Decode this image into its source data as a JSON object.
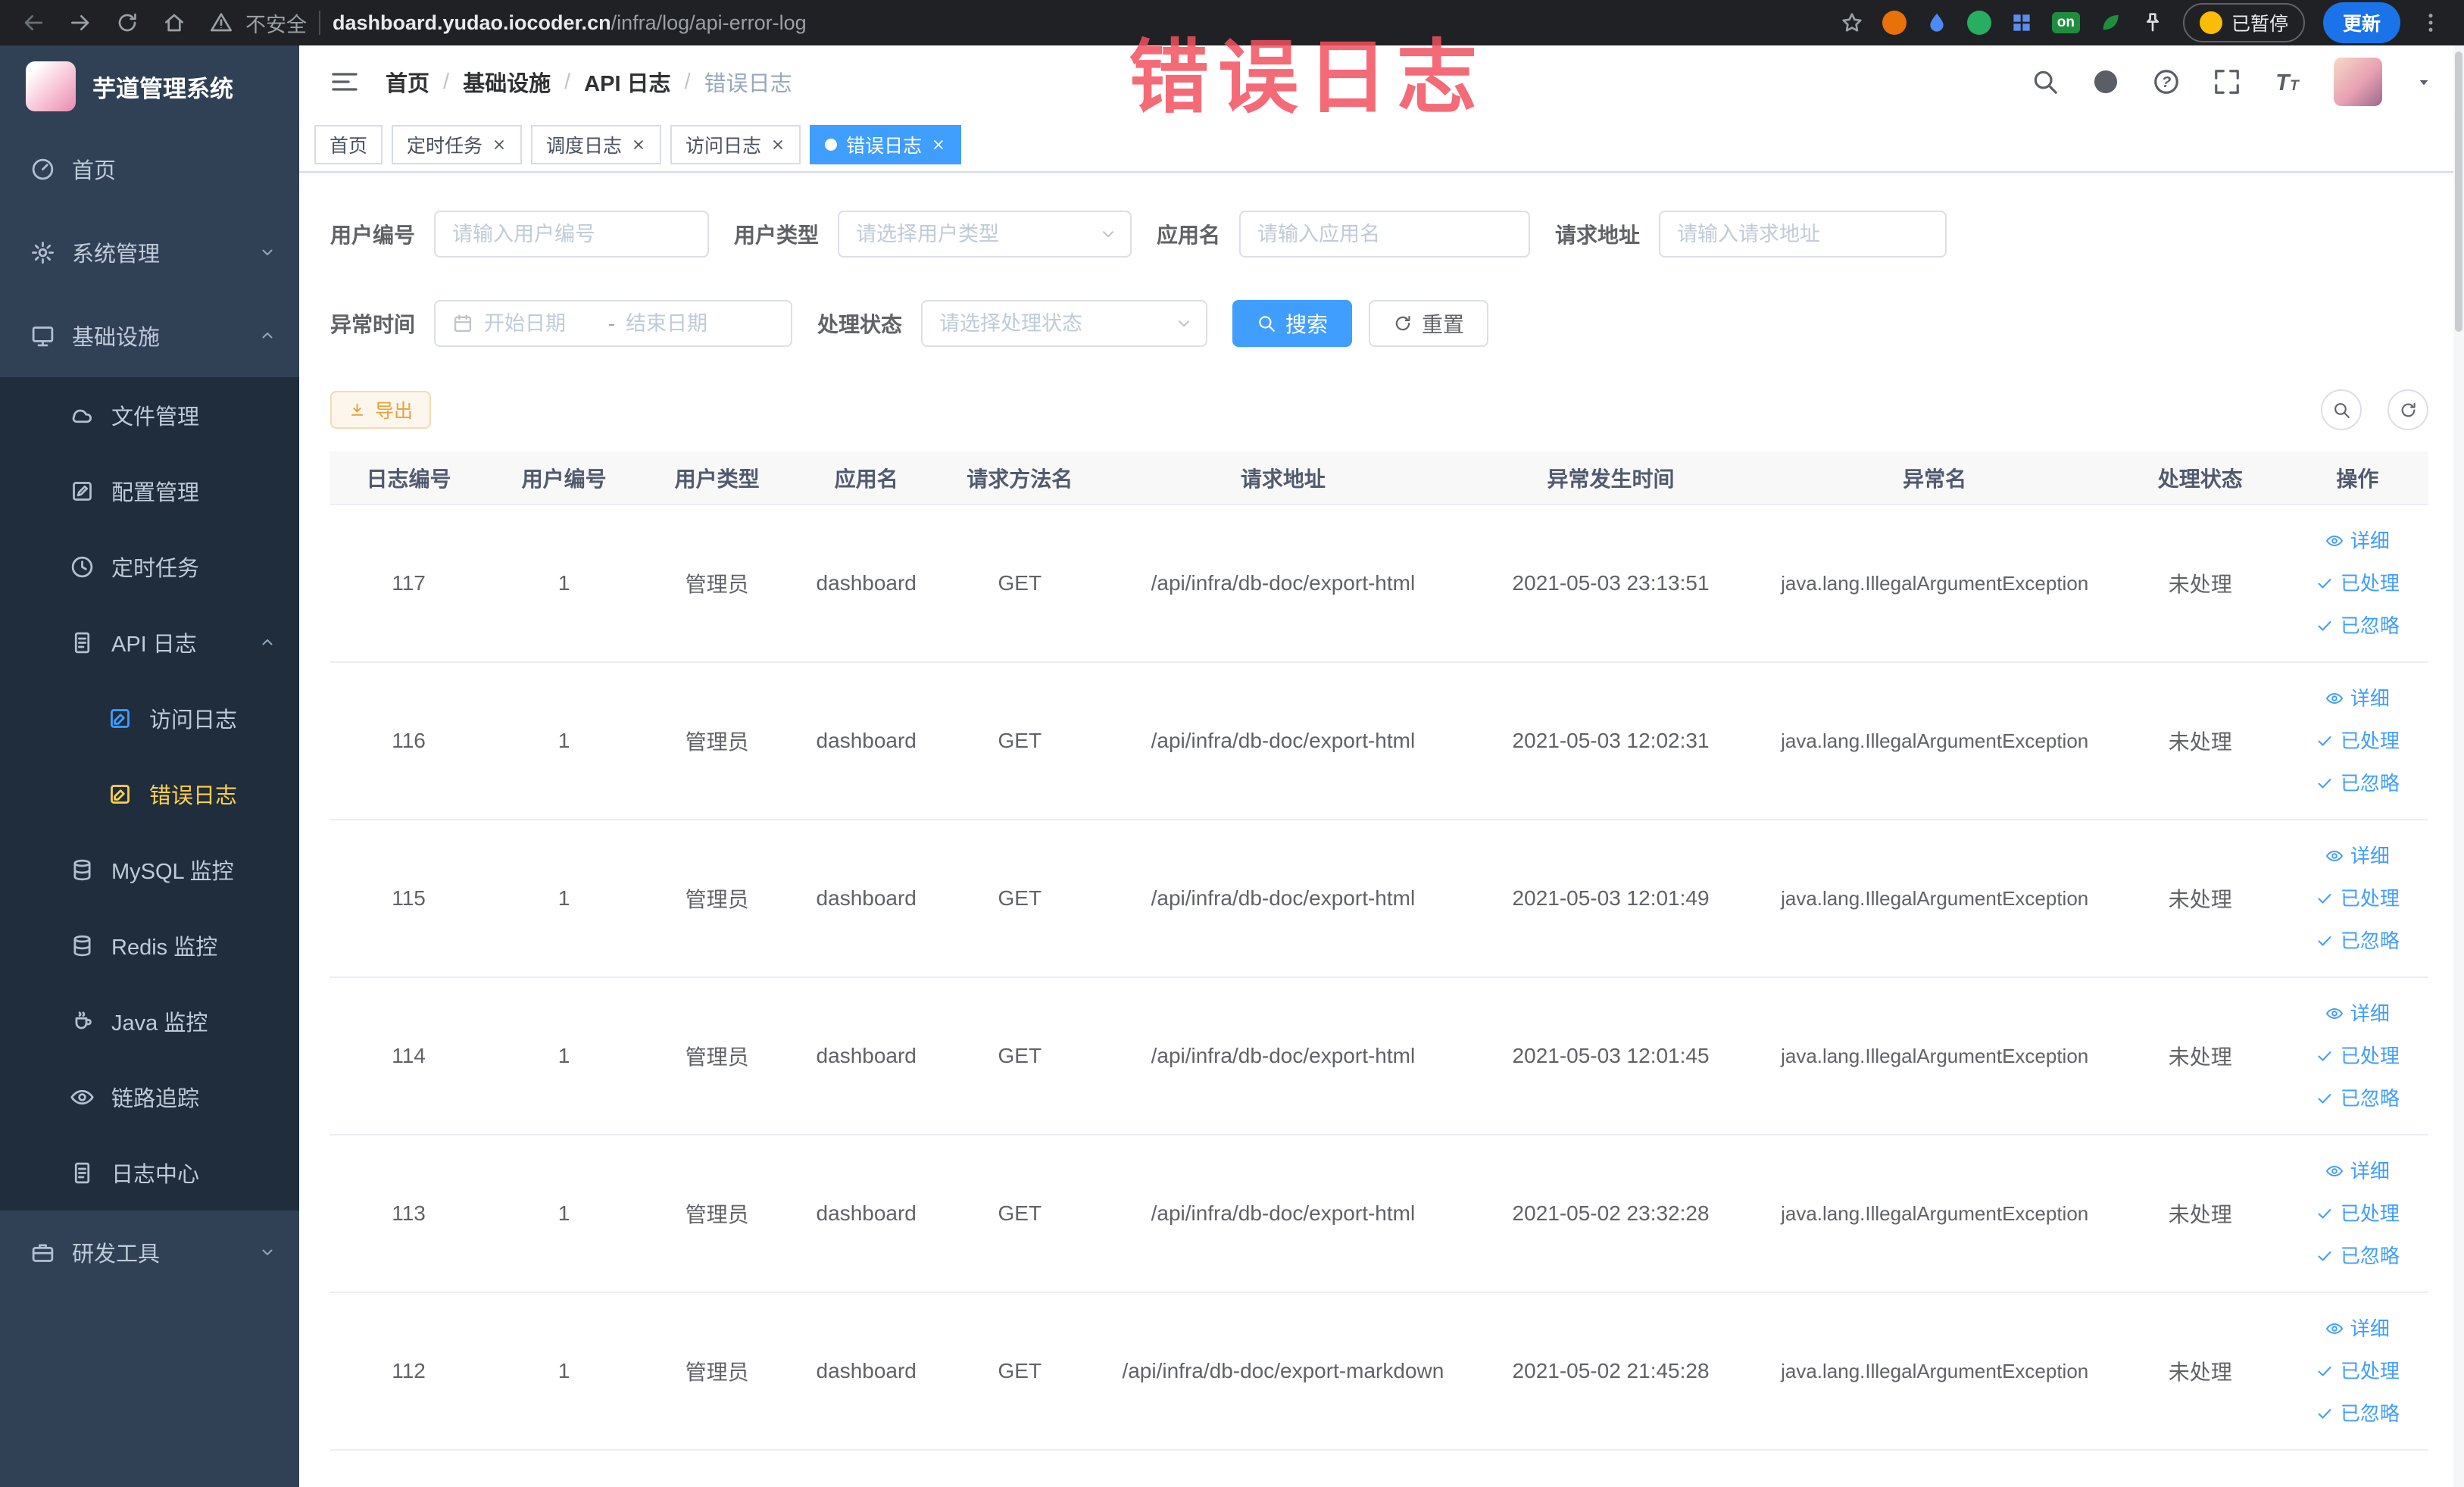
{
  "browser": {
    "security_label": "不安全",
    "url_domain": "dashboard.yudao.iocoder.cn",
    "url_path": "/infra/log/api-error-log",
    "extensions_badge": "on",
    "paused_label": "已暂停",
    "update_label": "更新"
  },
  "annotation": {
    "text": "错误日志",
    "color": "#f2505f"
  },
  "sidebar": {
    "logo_title": "芋道管理系统",
    "menu": [
      {
        "label": "首页"
      },
      {
        "label": "系统管理"
      },
      {
        "label": "基础设施"
      },
      {
        "label": "文件管理"
      },
      {
        "label": "配置管理"
      },
      {
        "label": "定时任务"
      },
      {
        "label": "API 日志"
      },
      {
        "label": "访问日志"
      },
      {
        "label": "错误日志"
      },
      {
        "label": "MySQL 监控"
      },
      {
        "label": "Redis 监控"
      },
      {
        "label": "Java 监控"
      },
      {
        "label": "链路追踪"
      },
      {
        "label": "日志中心"
      },
      {
        "label": "研发工具"
      }
    ]
  },
  "header": {
    "breadcrumb": [
      "首页",
      "基础设施",
      "API 日志",
      "错误日志"
    ],
    "separator": "/"
  },
  "tabs": [
    {
      "label": "首页"
    },
    {
      "label": "定时任务"
    },
    {
      "label": "调度日志"
    },
    {
      "label": "访问日志"
    },
    {
      "label": "错误日志"
    }
  ],
  "filters": {
    "user_id": {
      "label": "用户编号",
      "placeholder": "请输入用户编号"
    },
    "user_type": {
      "label": "用户类型",
      "placeholder": "请选择用户类型"
    },
    "app_name": {
      "label": "应用名",
      "placeholder": "请输入应用名"
    },
    "request_url": {
      "label": "请求地址",
      "placeholder": "请输入请求地址"
    },
    "exception_time": {
      "label": "异常时间",
      "start_placeholder": "开始日期",
      "end_placeholder": "结束日期",
      "separator": "-"
    },
    "process_status": {
      "label": "处理状态",
      "placeholder": "请选择处理状态"
    },
    "search_label": "搜索",
    "reset_label": "重置"
  },
  "toolbar": {
    "export_label": "导出"
  },
  "table": {
    "columns": [
      "日志编号",
      "用户编号",
      "用户类型",
      "应用名",
      "请求方法名",
      "请求地址",
      "异常发生时间",
      "异常名",
      "处理状态",
      "操作"
    ],
    "row_actions": [
      {
        "label": "详细",
        "icon": "eye-icon"
      },
      {
        "label": "已处理",
        "icon": "check-icon"
      },
      {
        "label": "已忽略",
        "icon": "check-icon"
      }
    ],
    "rows": [
      {
        "id": "117",
        "user_id": "1",
        "user_type": "管理员",
        "app": "dashboard",
        "method": "GET",
        "url": "/api/infra/db-doc/export-html",
        "time": "2021-05-03 23:13:51",
        "exception": "java.lang.IllegalArgumentException",
        "status": "未处理"
      },
      {
        "id": "116",
        "user_id": "1",
        "user_type": "管理员",
        "app": "dashboard",
        "method": "GET",
        "url": "/api/infra/db-doc/export-html",
        "time": "2021-05-03 12:02:31",
        "exception": "java.lang.IllegalArgumentException",
        "status": "未处理"
      },
      {
        "id": "115",
        "user_id": "1",
        "user_type": "管理员",
        "app": "dashboard",
        "method": "GET",
        "url": "/api/infra/db-doc/export-html",
        "time": "2021-05-03 12:01:49",
        "exception": "java.lang.IllegalArgumentException",
        "status": "未处理"
      },
      {
        "id": "114",
        "user_id": "1",
        "user_type": "管理员",
        "app": "dashboard",
        "method": "GET",
        "url": "/api/infra/db-doc/export-html",
        "time": "2021-05-03 12:01:45",
        "exception": "java.lang.IllegalArgumentException",
        "status": "未处理"
      },
      {
        "id": "113",
        "user_id": "1",
        "user_type": "管理员",
        "app": "dashboard",
        "method": "GET",
        "url": "/api/infra/db-doc/export-html",
        "time": "2021-05-02 23:32:28",
        "exception": "java.lang.IllegalArgumentException",
        "status": "未处理"
      },
      {
        "id": "112",
        "user_id": "1",
        "user_type": "管理员",
        "app": "dashboard",
        "method": "GET",
        "url": "/api/infra/db-doc/export-markdown",
        "time": "2021-05-02 21:45:28",
        "exception": "java.lang.IllegalArgumentException",
        "status": "未处理"
      }
    ]
  },
  "icons": {
    "search": "magnifier",
    "github": "octocat-circle",
    "help": "question-circle",
    "fullscreen": "expand-arrows",
    "font_size": "text-size",
    "refresh": "circular-arrow",
    "export": "download-arrow",
    "detail": "eye",
    "processed": "check",
    "ignored": "check"
  }
}
